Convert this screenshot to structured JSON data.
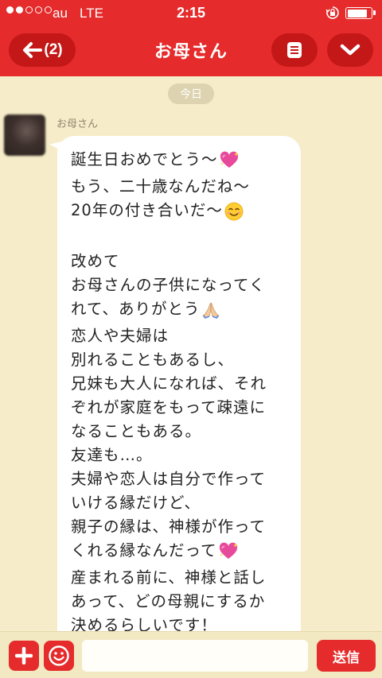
{
  "status_bar": {
    "signal_dots": [
      "full",
      "full",
      "empty",
      "empty",
      "empty"
    ],
    "carrier": "au",
    "network": "LTE",
    "time": "2:15"
  },
  "nav": {
    "back_label": "(2)",
    "title": "お母さん"
  },
  "chat": {
    "date_label": "今日",
    "sender_name": "お母さん",
    "message_lines": [
      "誕生日おめでとう〜",
      "もう、二十歳なんだね〜",
      "20年の付き合いだ〜",
      "",
      "改めて",
      "お母さんの子供になってく",
      "れて、ありがとう",
      "恋人や夫婦は",
      "別れることもあるし、",
      "兄妹も大人になれば、それ",
      "ぞれが家庭をもって疎遠に",
      "なることもある。",
      "友達も…。",
      "夫婦や恋人は自分で作って",
      "いける縁だけど、",
      "親子の縁は、神様が作って",
      "くれる縁なんだって",
      "産まれる前に、神様と話し",
      "あって、どの母親にするか",
      "決めるらしいです！"
    ],
    "line_emojis": {
      "0": "sparkling-heart",
      "2": "smiling-face",
      "6": "praying-hands",
      "16": "sparkling-heart"
    }
  },
  "input_bar": {
    "placeholder": "",
    "send_label": "送信"
  },
  "colors": {
    "brand_red": "#e52b2b",
    "dark_red": "#c41717",
    "chat_background": "#f6ecc9",
    "bubble": "#ffffff"
  }
}
